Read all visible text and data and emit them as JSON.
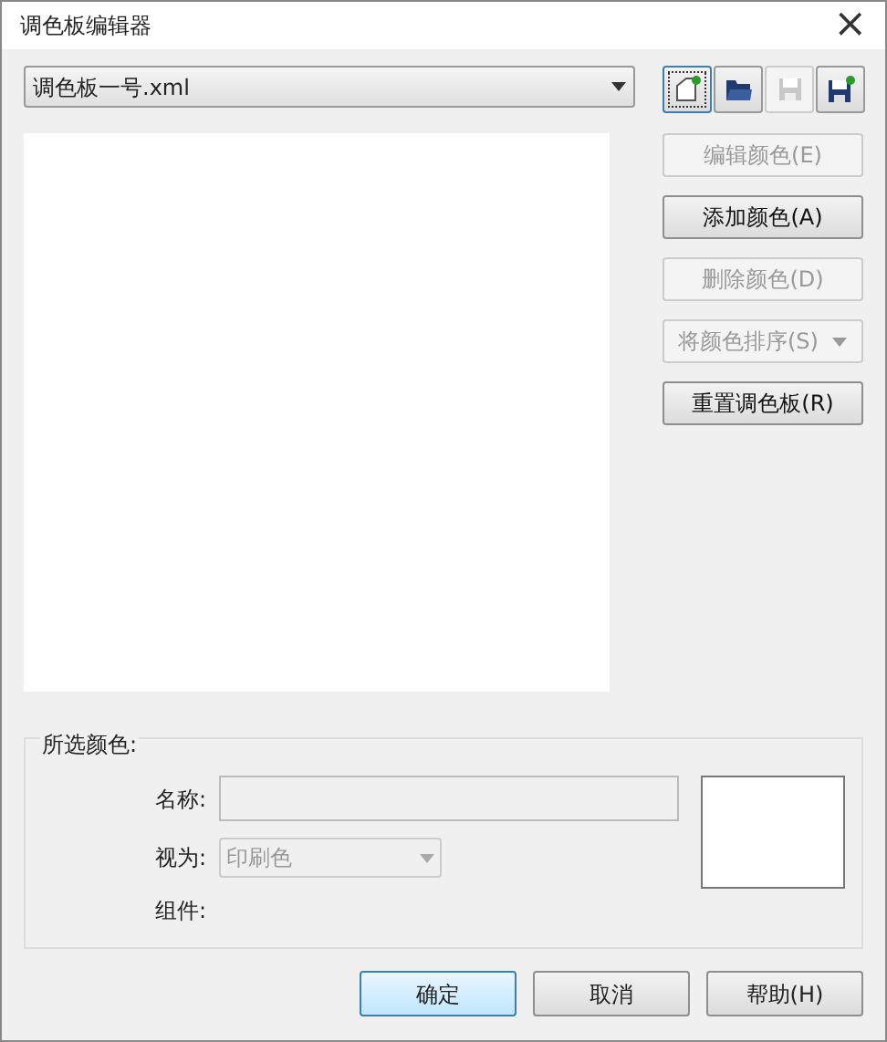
{
  "window": {
    "title": "调色板编辑器",
    "close": "×"
  },
  "palette_select": {
    "value": "调色板一号.xml"
  },
  "toolbar": [
    {
      "kind": "new",
      "disabled": false,
      "focused": true
    },
    {
      "kind": "open",
      "disabled": false,
      "focused": false
    },
    {
      "kind": "save",
      "disabled": true,
      "focused": false
    },
    {
      "kind": "save_as",
      "disabled": false,
      "focused": false
    }
  ],
  "side_buttons": [
    {
      "label": "编辑颜色(E)",
      "disabled": true,
      "dropdown": false
    },
    {
      "label": "添加颜色(A)",
      "disabled": false,
      "dropdown": false
    },
    {
      "label": "删除颜色(D)",
      "disabled": true,
      "dropdown": false
    },
    {
      "label": "将颜色排序(S)",
      "disabled": true,
      "dropdown": true
    },
    {
      "label": "重置调色板(R)",
      "disabled": false,
      "dropdown": false
    }
  ],
  "selected_color": {
    "title": "所选颜色:",
    "name_label": "名称:",
    "view_label": "视为:",
    "view_value": "印刷色",
    "components_label": "组件:"
  },
  "buttons": [
    {
      "label": "确定",
      "default": true
    },
    {
      "label": "取消",
      "default": false
    },
    {
      "label": "帮助(H)",
      "default": false
    }
  ]
}
